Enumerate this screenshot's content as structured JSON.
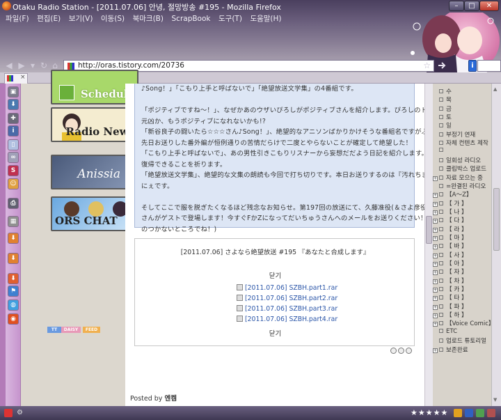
{
  "window": {
    "title": "Otaku Radio Station - [2011.07.06] 안녕, 절망방송 #195 - Mozilla Firefox"
  },
  "menu": [
    "파일(F)",
    "편집(E)",
    "보기(V)",
    "이동(S)",
    "북마크(B)",
    "ScrapBook",
    "도구(T)",
    "도움말(H)"
  ],
  "address": {
    "url": "http://oras.tistory.com/20736"
  },
  "left_banners": [
    {
      "label": "Schedule",
      "color": "#a8d86a"
    },
    {
      "label": "Radio News",
      "color": "#f4ecd0"
    },
    {
      "label": "Anissia",
      "color": "#5a6a8a"
    },
    {
      "label": "ORS CHAT",
      "color": "#7ab0e0"
    }
  ],
  "badges": [
    {
      "label": "TT",
      "color": "#6a9ae0"
    },
    {
      "label": "DAISY",
      "color": "#e89ab8"
    },
    {
      "label": "FEED",
      "color": "#f0b050"
    }
  ],
  "post": {
    "lines": [
      "♪Song！」「こもり上手と呼ばないで」「絶望放送文学集」の4番組です。",
      "",
      "「ポジティブですね～！」、なぜかあのウザいぴろしがポジティブさんを紹介します。ぴろしのトラウマが",
      "元凶か、もうポジティブになれないかも!?",
      "「新谷良子の闘いたら☆☆☆さん♪Song！」、絶望的なアニソンばかりかけそうな番組名ですがふつあたやす。",
      "先日お送りした番外編が恒例通りの苦情だらけで二度とやらないことが確定して絶望した！",
      "「こもり上手と呼ばないで」、あの男性引きこもりリスナーから妄想だだよう日記を紹介します。早く社会",
      "復帰できることを祈ります。",
      "「絶望放送文学集」、絶望的な文集の朗読も今回で打ち切りです。本日お送りするのは『汚れちまった放送",
      "にぇです。",
      "",
      "そしてここで服を脱ぎたくなるほど残念なお知らせ。第197回の放送にて、久藤准役(＆さよ彦役)の水島大宙",
      "さんがゲストで登場します！今すぐFかZになってだいちゅうさんへのメールをお送りください！(ただし入目",
      "のつかないところでね！)"
    ]
  },
  "attachments": {
    "title": "[2011.07.06] さよなら絶望放送 #195 『あなたと合成します』",
    "close_label": "닫기",
    "files": [
      "[2011.07.06] SZBH.part1.rar",
      "[2011.07.06] SZBH.part2.rar",
      "[2011.07.06] SZBH.part3.rar",
      "[2011.07.06] SZBH.part4.rar"
    ]
  },
  "posted_by": {
    "prefix": "Posted by",
    "author": "엔켐"
  },
  "right_sidebar": {
    "items": [
      {
        "text": "수",
        "plus": false
      },
      {
        "text": "목",
        "plus": false
      },
      {
        "text": "금",
        "plus": false
      },
      {
        "text": "토",
        "plus": false
      },
      {
        "text": "일",
        "plus": false
      },
      {
        "text": "부정기 연재",
        "plus": false
      },
      {
        "text": "자체 컨텐츠 제작",
        "plus": false
      },
      {
        "text": "",
        "plus": false
      },
      {
        "text": "일회성 라디오",
        "plus": false
      },
      {
        "text": "클립박스 업로드",
        "plus": false
      },
      {
        "text": "자료 모으는 중",
        "plus": true
      },
      {
        "text": "=완결된 라디오",
        "plus": false
      },
      {
        "text": "【A～Z】",
        "plus": true
      },
      {
        "text": "【 가 】",
        "plus": true
      },
      {
        "text": "【 나 】",
        "plus": true
      },
      {
        "text": "【 다 】",
        "plus": true
      },
      {
        "text": "【 라 】",
        "plus": true
      },
      {
        "text": "【 마 】",
        "plus": true
      },
      {
        "text": "【 바 】",
        "plus": true
      },
      {
        "text": "【 사 】",
        "plus": true
      },
      {
        "text": "【 아 】",
        "plus": true
      },
      {
        "text": "【 자 】",
        "plus": true
      },
      {
        "text": "【 차 】",
        "plus": true
      },
      {
        "text": "【 카 】",
        "plus": true
      },
      {
        "text": "【 타 】",
        "plus": true
      },
      {
        "text": "【 파 】",
        "plus": true
      },
      {
        "text": "【 하 】",
        "plus": true
      },
      {
        "text": "【Voice Comic】",
        "plus": true
      },
      {
        "text": "ETC",
        "plus": false
      },
      {
        "text": "업로드 튜토리얼",
        "plus": false
      },
      {
        "text": "보존완료",
        "plus": true
      }
    ]
  }
}
